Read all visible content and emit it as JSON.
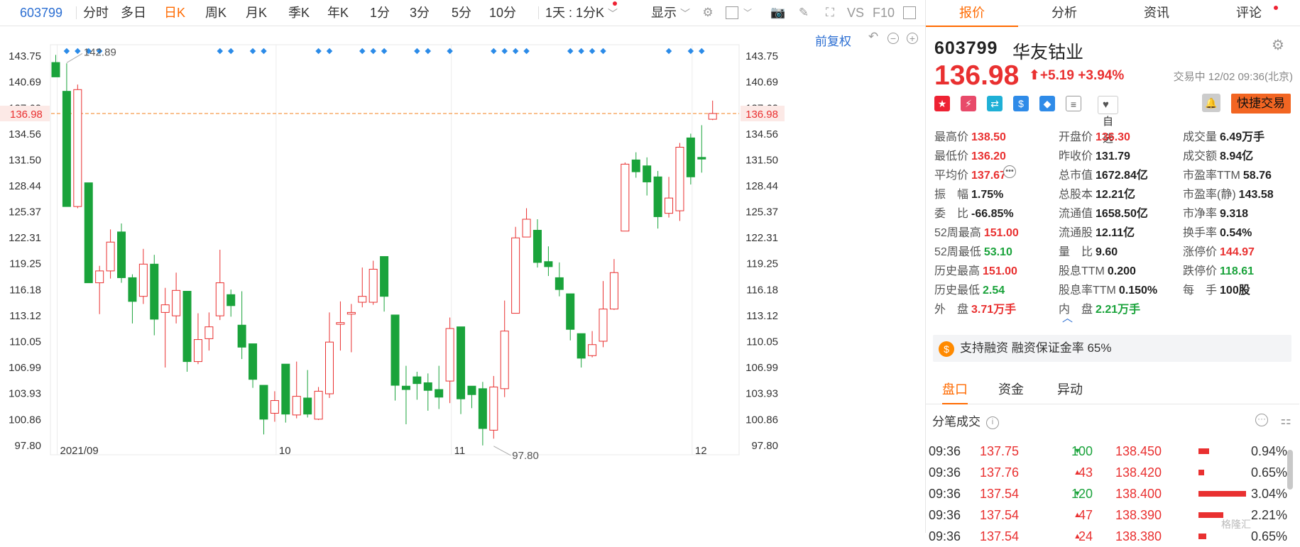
{
  "toolbar": {
    "code": "603799",
    "items": [
      "分时",
      "多日",
      "日K",
      "周K",
      "月K",
      "季K",
      "年K",
      "1分",
      "3分",
      "5分",
      "10分"
    ],
    "active": "日K",
    "interval": "1天 : 1分K",
    "display": "显示",
    "vs": "VS",
    "f10": "F10"
  },
  "chart_controls": {
    "adjust": "前复权"
  },
  "chart_data": {
    "type": "candlestick",
    "ylim": [
      96.7,
      145.1
    ],
    "y_ticks": [
      "143.75",
      "140.69",
      "137.62",
      "134.56",
      "131.50",
      "128.44",
      "125.37",
      "122.31",
      "119.25",
      "116.18",
      "113.12",
      "110.05",
      "106.99",
      "103.93",
      "100.86",
      "97.80"
    ],
    "x_labels": [
      {
        "label": "2021/09",
        "index": 0.5
      },
      {
        "label": "10",
        "index": 20.5
      },
      {
        "label": "11",
        "index": 36.5
      },
      {
        "label": "12",
        "index": 58.5
      }
    ],
    "current_price": 136.98,
    "current_price_label": "136.98",
    "annotations": [
      {
        "label": "142.89",
        "index": 1,
        "value": 142.89
      },
      {
        "label": "97.80",
        "index": 40,
        "value": 97.8
      }
    ],
    "marker_indices": [
      1,
      2,
      3,
      4,
      15,
      16,
      18,
      19,
      24,
      25,
      28,
      29,
      30,
      33,
      34,
      36,
      40,
      41,
      42,
      43,
      47,
      48,
      49,
      50,
      56,
      58,
      59
    ],
    "ohlc": [
      [
        143,
        141.3,
        143.9,
        141.3
      ],
      [
        139.6,
        126,
        142.9,
        126
      ],
      [
        126,
        139.8,
        140.4,
        125.8
      ],
      [
        128.8,
        117,
        128.8,
        117
      ],
      [
        117,
        118.4,
        119,
        113.3
      ],
      [
        118.4,
        121.8,
        123.3,
        117.5
      ],
      [
        123,
        117.6,
        124,
        117
      ],
      [
        117.6,
        114.8,
        118,
        112.2
      ],
      [
        115.4,
        119.2,
        121,
        114.5
      ],
      [
        119.2,
        112.7,
        120.3,
        110.8
      ],
      [
        113.5,
        114.4,
        116.4,
        107
      ],
      [
        113.1,
        116.1,
        118.2,
        112.2
      ],
      [
        116,
        107.7,
        116,
        106.5
      ],
      [
        107.7,
        110.3,
        113.4,
        107.4
      ],
      [
        110.4,
        111.8,
        113.5,
        109
      ],
      [
        113.1,
        117,
        120.9,
        112.6
      ],
      [
        115.6,
        114.3,
        116.2,
        113
      ],
      [
        112,
        109.4,
        116,
        108
      ],
      [
        109.8,
        105.6,
        109.8,
        104.6
      ],
      [
        104.9,
        100.9,
        104.9,
        99.1
      ],
      [
        101.6,
        103.1,
        104.2,
        100.6
      ],
      [
        107.4,
        101.5,
        107.4,
        100.5
      ],
      [
        101.4,
        103.6,
        107.7,
        101
      ],
      [
        103.4,
        101.5,
        106.7,
        101.1
      ],
      [
        100.9,
        104.2,
        104.7,
        100.8
      ],
      [
        103.9,
        110,
        113.5,
        103.4
      ],
      [
        112.1,
        112.3,
        114.8,
        109
      ],
      [
        113.3,
        113.5,
        114.5,
        108.8
      ],
      [
        114.7,
        115.4,
        118.8,
        114.1
      ],
      [
        114.7,
        118.6,
        119.6,
        114.4
      ],
      [
        120.1,
        115.4,
        120.1,
        113.6
      ],
      [
        113.2,
        104.9,
        113.2,
        103.1
      ],
      [
        104.8,
        104.4,
        107.2,
        100.3
      ],
      [
        105.9,
        105.1,
        106.5,
        103.2
      ],
      [
        105.2,
        104.3,
        106.3,
        101.9
      ],
      [
        104.4,
        103.5,
        107.2,
        102.1
      ],
      [
        105.4,
        111.6,
        112.9,
        102.8
      ],
      [
        111.8,
        103.3,
        111.8,
        101.5
      ],
      [
        104.8,
        103.8,
        104.8,
        102.2
      ],
      [
        104.5,
        99.8,
        105.3,
        97.8
      ],
      [
        99.6,
        104.7,
        106,
        98.6
      ],
      [
        104.5,
        111.3,
        114.9,
        103.5
      ],
      [
        113.4,
        122.3,
        123.6,
        113.4
      ],
      [
        122.4,
        124.5,
        125.8,
        122.4
      ],
      [
        123.2,
        119.4,
        124.5,
        118.8
      ],
      [
        119.5,
        118.9,
        121.3,
        117.8
      ],
      [
        117.6,
        116.2,
        119.4,
        115.4
      ],
      [
        115.7,
        111.5,
        115.7,
        110.2
      ],
      [
        111,
        108.1,
        111,
        107
      ],
      [
        108.4,
        109.7,
        111.3,
        108.2
      ],
      [
        110.1,
        113.9,
        117.2,
        109.4
      ],
      [
        113.9,
        118.2,
        119.8,
        113.8
      ],
      [
        123.1,
        131,
        131.2,
        123.1
      ],
      [
        131.5,
        130.1,
        132.4,
        129.4
      ],
      [
        130.8,
        128.9,
        131.8,
        127.3
      ],
      [
        129.5,
        124.8,
        130.2,
        123.4
      ],
      [
        125.2,
        127,
        129.5,
        124.7
      ],
      [
        125.5,
        133,
        133.5,
        124.3
      ],
      [
        134.1,
        129.5,
        134.6,
        128.6
      ],
      [
        131.8,
        131.6,
        135.6,
        130
      ],
      [
        136.3,
        136.98,
        138.5,
        136.2
      ]
    ]
  },
  "tabs": [
    "报价",
    "分析",
    "资讯",
    "评论"
  ],
  "active_tab": "报价",
  "stock": {
    "code": "603799",
    "name": "华友钴业",
    "price": "136.98",
    "arrow": "⬆",
    "change": "+5.19",
    "change_pct": "+3.94%",
    "status": "交易中 12/02 09:36(北京)"
  },
  "actions": {
    "watchlist": "自选",
    "quick_trade": "快捷交易"
  },
  "quote": {
    "col1": [
      {
        "k": "最高价",
        "v": "138.50",
        "c": "red"
      },
      {
        "k": "最低价",
        "v": "136.20",
        "c": "red"
      },
      {
        "k": "平均价",
        "v": "137.67",
        "c": "red"
      },
      {
        "k": "振　幅",
        "v": "1.75%",
        "c": "dark"
      },
      {
        "k": "委　比",
        "v": "-66.85%",
        "c": "dark"
      },
      {
        "k": "52周最高",
        "v": "151.00",
        "c": "red"
      },
      {
        "k": "52周最低",
        "v": "53.10",
        "c": "green"
      },
      {
        "k": "历史最高",
        "v": "151.00",
        "c": "red"
      },
      {
        "k": "历史最低",
        "v": "2.54",
        "c": "green"
      },
      {
        "k": "外　盘",
        "v": "3.71万手",
        "c": "red"
      }
    ],
    "col2": [
      {
        "k": "开盘价",
        "v": "136.30",
        "c": "red"
      },
      {
        "k": "昨收价",
        "v": "131.79",
        "c": "dark"
      },
      {
        "k": "总市值",
        "v": "1672.84亿",
        "c": "dark"
      },
      {
        "k": "总股本",
        "v": "12.21亿",
        "c": "dark"
      },
      {
        "k": "流通值",
        "v": "1658.50亿",
        "c": "dark"
      },
      {
        "k": "流通股",
        "v": "12.11亿",
        "c": "dark"
      },
      {
        "k": "量　比",
        "v": "9.60",
        "c": "dark"
      },
      {
        "k": "股息TTM",
        "v": "0.200",
        "c": "dark"
      },
      {
        "k": "股息率TTM",
        "v": "0.150%",
        "c": "dark"
      },
      {
        "k": "内　盘",
        "v": "2.21万手",
        "c": "green"
      }
    ],
    "col3": [
      {
        "k": "成交量",
        "v": "6.49万手",
        "c": "dark"
      },
      {
        "k": "成交额",
        "v": "8.94亿",
        "c": "dark"
      },
      {
        "k": "市盈率TTM",
        "v": "58.76",
        "c": "dark"
      },
      {
        "k": "市盈率(静)",
        "v": "143.58",
        "c": "dark"
      },
      {
        "k": "市净率",
        "v": "9.318",
        "c": "dark"
      },
      {
        "k": "换手率",
        "v": "0.54%",
        "c": "dark"
      },
      {
        "k": "涨停价",
        "v": "144.97",
        "c": "red"
      },
      {
        "k": "跌停价",
        "v": "118.61",
        "c": "green"
      },
      {
        "k": "每　手",
        "v": "100股",
        "c": "dark"
      }
    ]
  },
  "margin_banner": "支持融资 融资保证金率 65%",
  "subtabs": [
    "盘口",
    "资金",
    "异动"
  ],
  "active_subtab": "盘口",
  "ticks": {
    "title": "分笔成交",
    "rows": [
      {
        "time": "09:36",
        "price": "137.75",
        "vol": "100",
        "dir": "down",
        "level": "138.450",
        "bar": 0.11,
        "pct": "0.94%"
      },
      {
        "time": "09:36",
        "price": "137.76",
        "vol": "43",
        "dir": "up",
        "level": "138.420",
        "bar": 0.06,
        "pct": "0.65%"
      },
      {
        "time": "09:36",
        "price": "137.54",
        "vol": "120",
        "dir": "down",
        "level": "138.400",
        "bar": 0.48,
        "pct": "3.04%"
      },
      {
        "time": "09:36",
        "price": "137.54",
        "vol": "47",
        "dir": "up",
        "level": "138.390",
        "bar": 0.25,
        "pct": "2.21%"
      },
      {
        "time": "09:36",
        "price": "137.54",
        "vol": "24",
        "dir": "up",
        "level": "138.380",
        "bar": 0.08,
        "pct": "0.65%"
      }
    ]
  },
  "watermark": "格隆汇"
}
